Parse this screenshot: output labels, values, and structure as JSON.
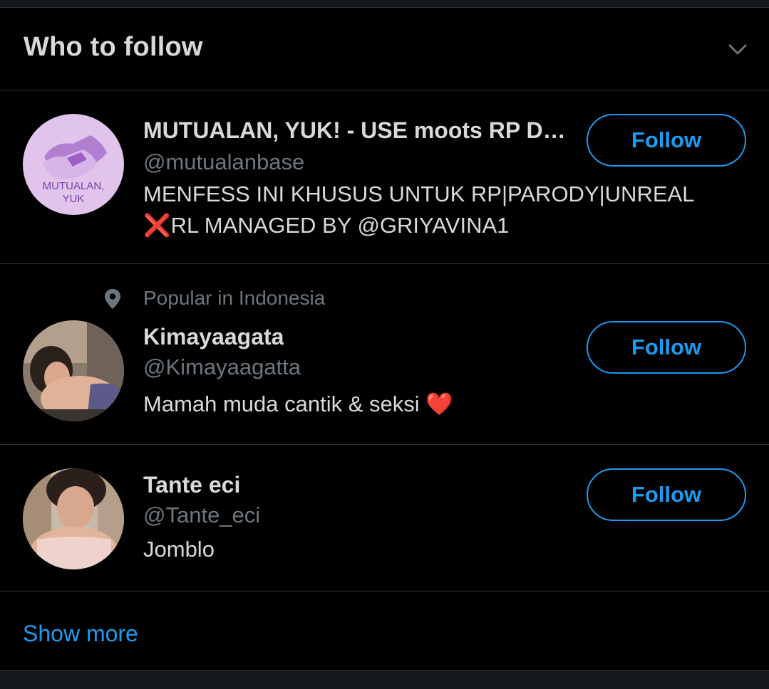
{
  "header": {
    "title": "Who to follow",
    "collapse_icon": "chevron-down-icon"
  },
  "users": [
    {
      "name": "MUTUALAN, YUK! - USE moots RP DOAN...",
      "handle": "@mutualanbase",
      "bio_lines": [
        "MENFESS INI KHUSUS UNTUK RP|PARODY|UNREAL",
        "❌RL MANAGED BY @GRIYAVINA1"
      ],
      "follow_label": "Follow",
      "avatar_text_1": "MUTUALAN,",
      "avatar_text_2": "YUK"
    },
    {
      "context": "Popular in Indonesia",
      "context_icon": "location-pin-icon",
      "name": "Kimayaagata",
      "handle": "@Kimayaagatta",
      "bio": "Mamah muda cantik & seksi ❤️",
      "follow_label": "Follow"
    },
    {
      "name": "Tante eci",
      "handle": "@Tante_eci",
      "bio": "Jomblo",
      "follow_label": "Follow"
    }
  ],
  "footer": {
    "show_more": "Show more"
  },
  "colors": {
    "accent": "#1d9bf0",
    "background": "#000000",
    "divider": "#2f3336",
    "secondary_text": "#6e767d",
    "primary_text": "#d9d9d9"
  }
}
